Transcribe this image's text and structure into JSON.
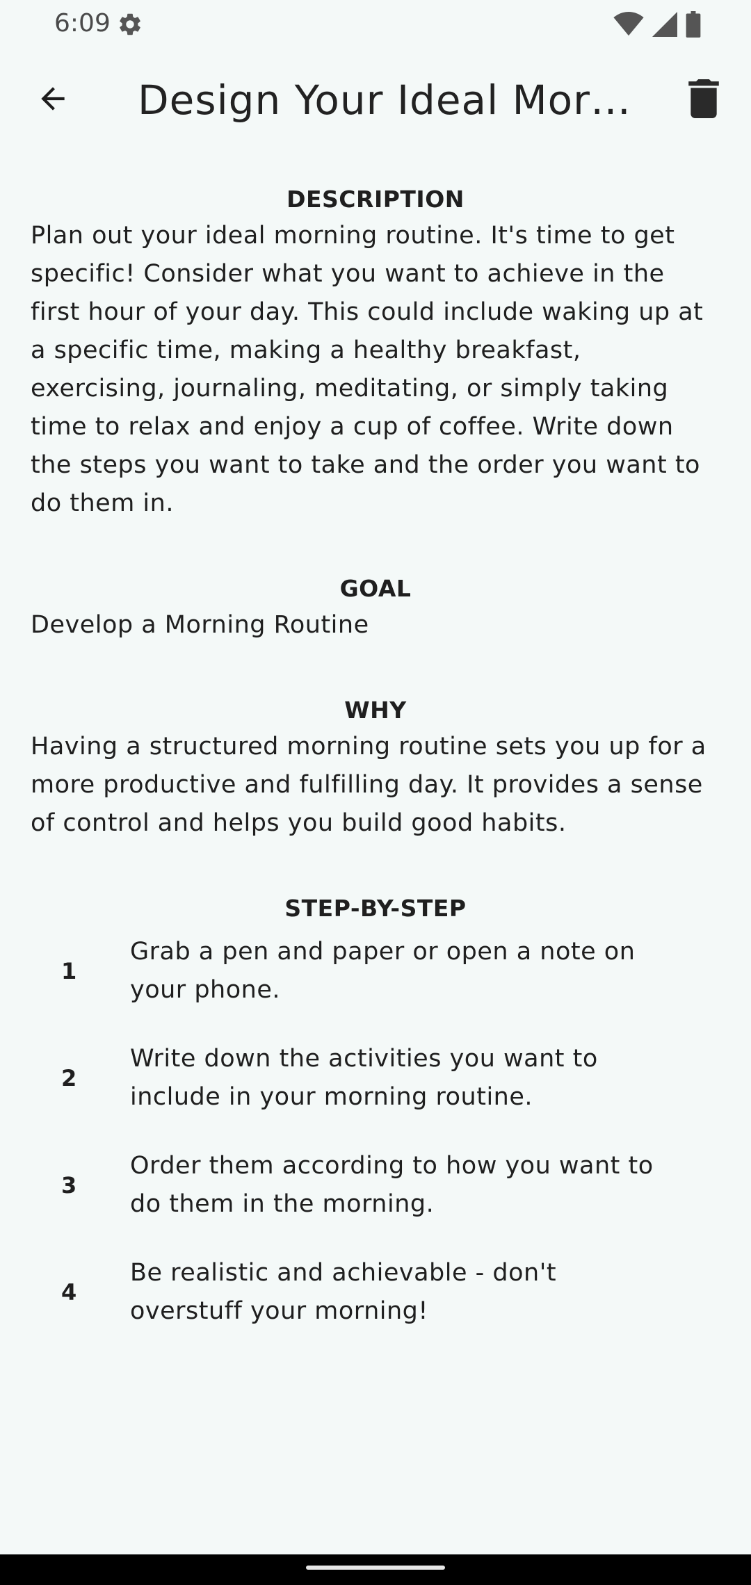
{
  "status_bar": {
    "time": "6:09",
    "icons": [
      "settings-gear-icon",
      "wifi-icon",
      "cellular-signal-icon",
      "battery-icon"
    ]
  },
  "app_bar": {
    "title": "Design Your Ideal Mor…",
    "back_icon": "arrow-back-icon",
    "delete_icon": "trash-icon"
  },
  "sections": {
    "description": {
      "heading": "DESCRIPTION",
      "body": "Plan out your ideal morning routine. It's time to get specific! Consider what you want to achieve in the first hour of your day. This could include waking up at a specific time, making a healthy breakfast, exercising, journaling, meditating, or simply taking time to relax and enjoy a cup of coffee. Write down the steps you want to take and the order you want to do them in."
    },
    "goal": {
      "heading": "GOAL",
      "body": "Develop a Morning Routine"
    },
    "why": {
      "heading": "WHY",
      "body": "Having a structured morning routine sets you up for a more productive and fulfilling day. It provides a sense of control and helps you build good habits."
    },
    "steps": {
      "heading": "STEP-BY-STEP",
      "items": [
        {
          "num": "1",
          "text": "Grab a pen and paper or open a note on your phone."
        },
        {
          "num": "2",
          "text": "Write down the activities you want to include in your morning routine."
        },
        {
          "num": "3",
          "text": "Order them according to how you want to do them in the morning."
        },
        {
          "num": "4",
          "text": "Be realistic and achievable - don't overstuff your morning!"
        }
      ]
    }
  }
}
